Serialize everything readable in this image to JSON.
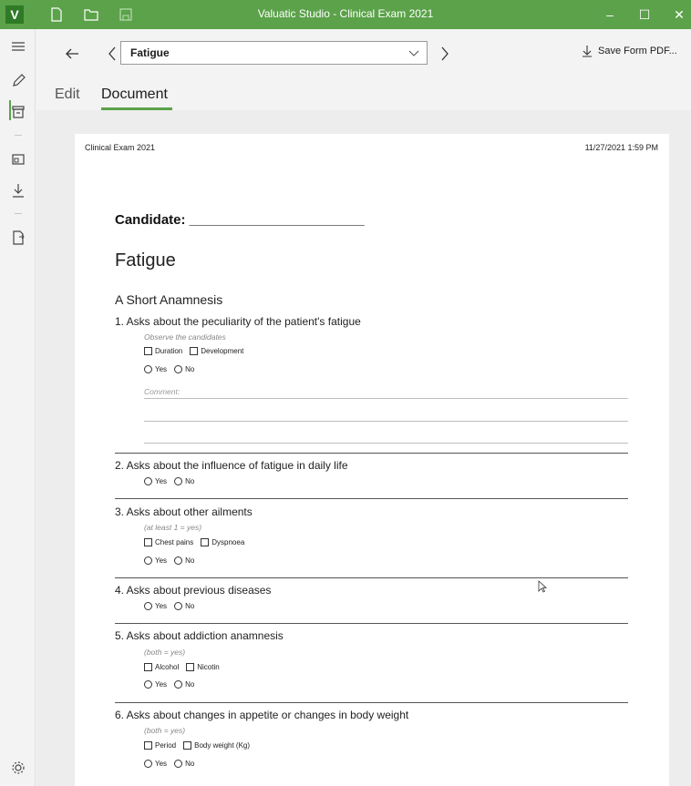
{
  "titlebar": {
    "logo": "V",
    "title": "Valuatic Studio - Clinical Exam 2021",
    "minimize": "–",
    "maximize": "☐",
    "close": "✕"
  },
  "nav": {
    "selected_item": "Fatigue",
    "save_pdf_label": "Save Form PDF..."
  },
  "tabs": {
    "edit": "Edit",
    "document": "Document",
    "active": "Document"
  },
  "page": {
    "header_left": "Clinical Exam 2021",
    "header_right": "11/27/2021 1:59 PM",
    "candidate": "Candidate: _______________________",
    "title": "Fatigue",
    "section": "A  Short Anamnesis",
    "yes": "Yes",
    "no": "No",
    "comment_label": "Comment:",
    "questions": [
      {
        "text": "1.  Asks about the peculiarity of the patient's fatigue",
        "note": "Observe the candidates",
        "options": [
          "Duration",
          "Development"
        ]
      },
      {
        "text": "2.  Asks about the influence of fatigue in daily life"
      },
      {
        "text": "3.  Asks about other ailments",
        "note": "(at least 1 = yes)",
        "options": [
          "Chest pains",
          "Dyspnoea"
        ]
      },
      {
        "text": "4.  Asks about previous diseases"
      },
      {
        "text": "5.  Asks about addiction anamnesis",
        "note": "(both = yes)",
        "options": [
          "Alcohol",
          "Nicotin"
        ]
      },
      {
        "text": "6.  Asks about changes in appetite or changes in body weight",
        "note": "(both = yes)",
        "options": [
          "Period",
          "Body weight (Kg)"
        ]
      }
    ]
  },
  "colors": {
    "accent": "#5ba24a",
    "accent_dark": "#2f7a27"
  }
}
